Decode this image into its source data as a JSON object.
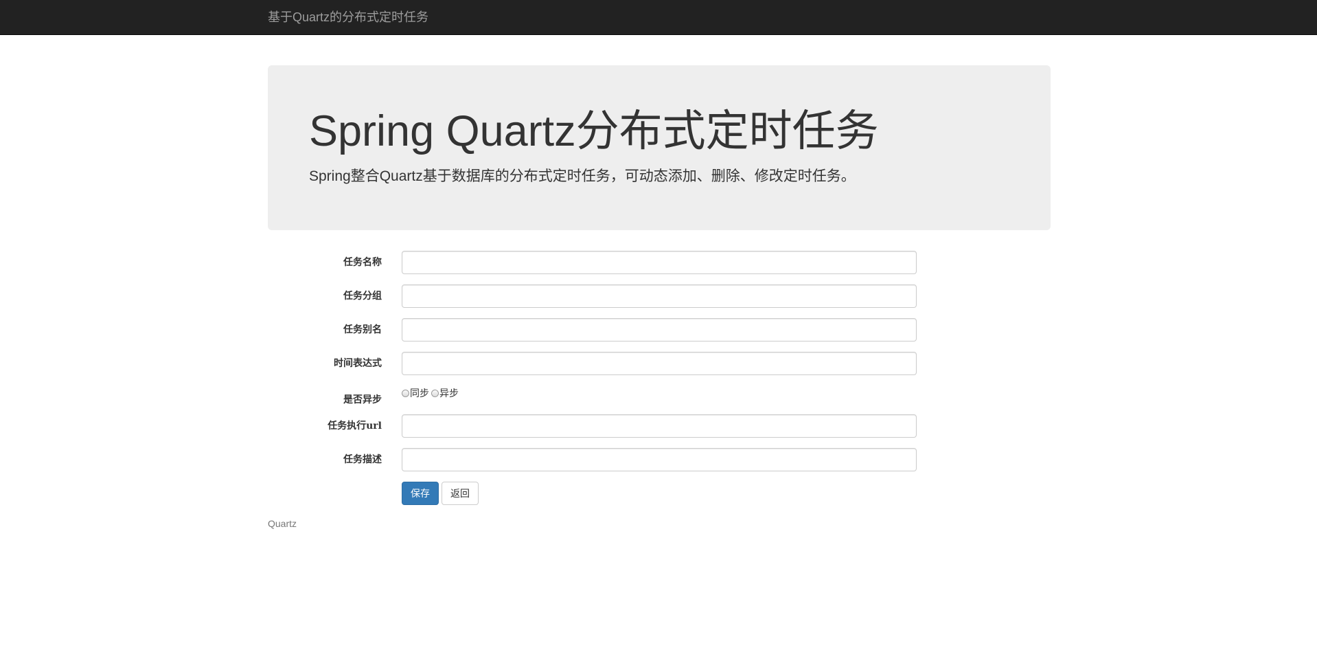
{
  "navbar": {
    "brand": "基于Quartz的分布式定时任务"
  },
  "jumbotron": {
    "title": "Spring Quartz分布式定时任务",
    "subtitle": "Spring整合Quartz基于数据库的分布式定时任务，可动态添加、删除、修改定时任务。"
  },
  "form": {
    "job_name_label": "任务名称",
    "job_name_value": "",
    "job_group_label": "任务分组",
    "job_group_value": "",
    "job_alias_label": "任务别名",
    "job_alias_value": "",
    "cron_label": "时间表达式",
    "cron_value": "",
    "async_label": "是否异步",
    "async_options": [
      "同步",
      "异步"
    ],
    "url_label": "任务执行url",
    "url_value": "",
    "desc_label": "任务描述",
    "desc_value": "",
    "save_label": "保存",
    "back_label": "返回"
  },
  "footer": {
    "text": "Quartz"
  },
  "colors": {
    "navbar_bg": "#222222",
    "jumbotron_bg": "#eeeeee",
    "primary": "#337ab7"
  }
}
